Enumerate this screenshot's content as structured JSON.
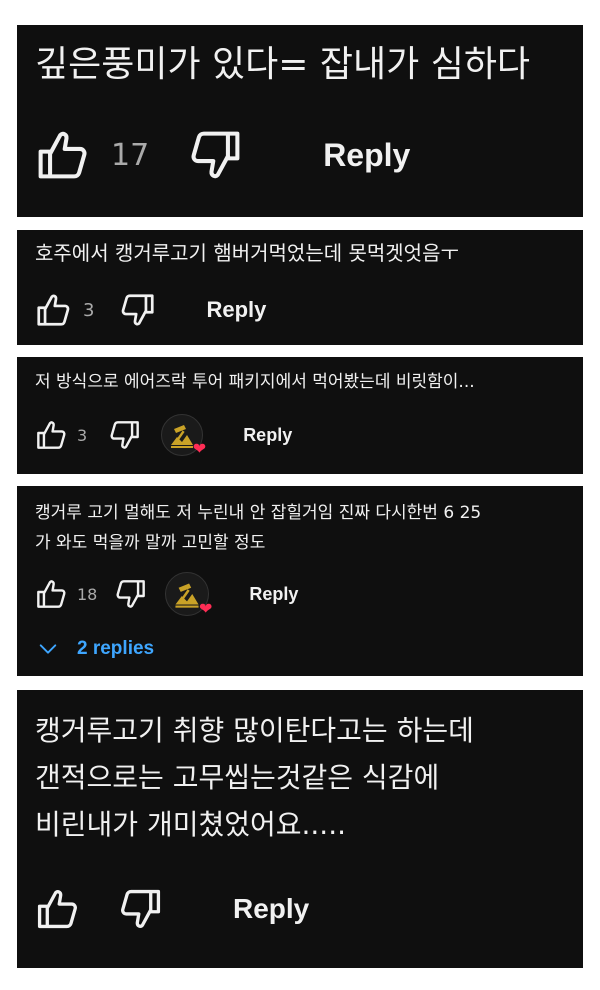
{
  "comments": [
    {
      "text": "깊은풍미가 있다= 잡내가 심하다",
      "likes": "17",
      "reply_label": "Reply"
    },
    {
      "text": "호주에서 캥거루고기 햄버거먹었는데 못먹겟엇음ㅜ",
      "likes": "3",
      "reply_label": "Reply"
    },
    {
      "text": "저 방식으로 에어즈락 투어 패키지에서 먹어봤는데 비릿함이...",
      "likes": "3",
      "reply_label": "Reply"
    },
    {
      "text": "캥거루 고기 멀해도 저 누린내 안 잡힐거임 진짜 다시한번 6 25\n가 와도 먹을까 말까 고민할 정도",
      "likes": "18",
      "reply_label": "Reply",
      "replies_label": "2 replies"
    },
    {
      "text": "캥거루고기 취향 많이탄다고는 하는데\n갠적으로는 고무씹는것같은 식감에\n비린내가 개미쳤었어요.....",
      "likes": "",
      "reply_label": "Reply"
    }
  ],
  "icons": {
    "like": "thumbs-up-icon",
    "dislike": "thumbs-down-icon",
    "expand": "chevron-down-icon",
    "heart": "heart-icon"
  },
  "colors": {
    "card_bg": "#0f0f0f",
    "text": "#f1f1f1",
    "muted": "#aaaaaa",
    "link": "#3ea6ff",
    "heart": "#ff2d55"
  }
}
